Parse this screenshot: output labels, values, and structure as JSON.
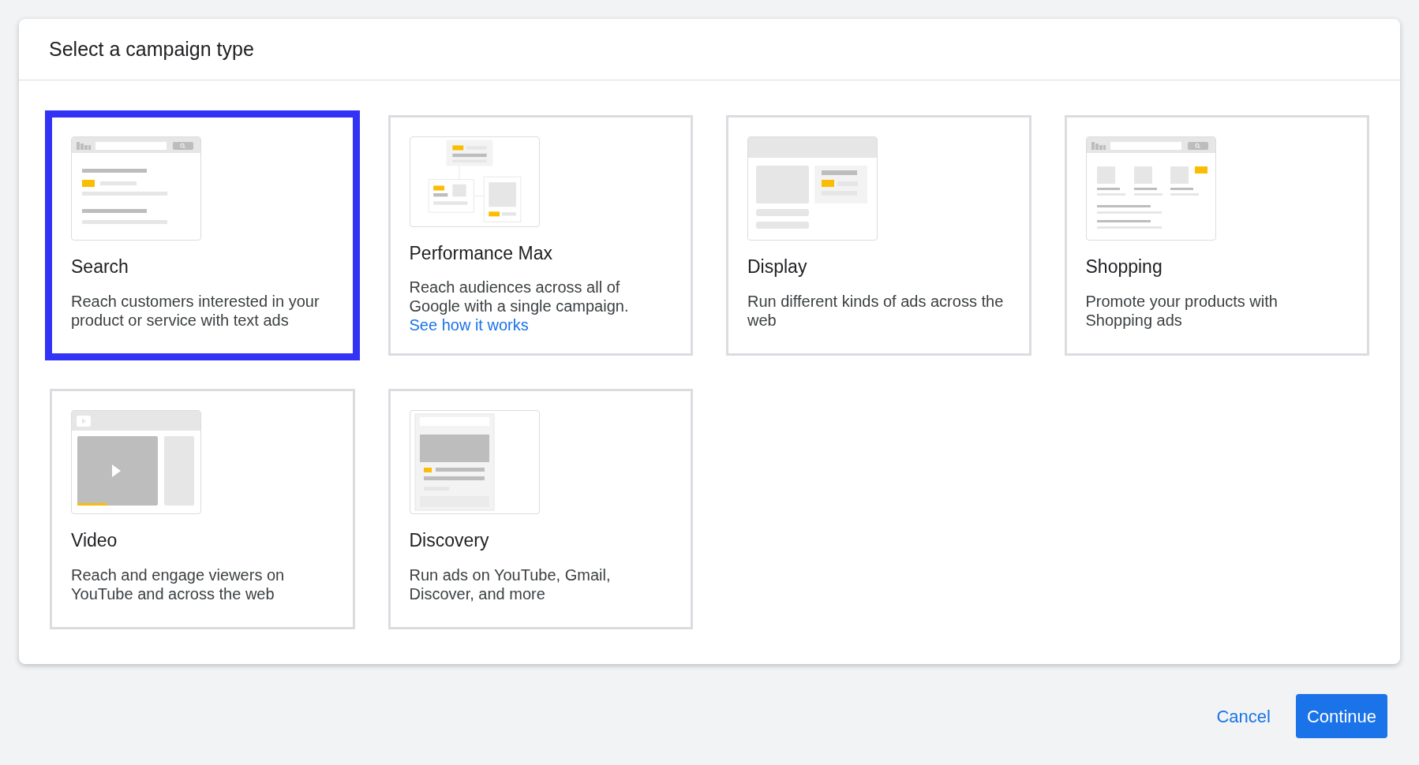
{
  "dialog": {
    "title": "Select a campaign type"
  },
  "cards": [
    {
      "kind": "search",
      "title": "Search",
      "description": "Reach customers interested in your product or service with text ads",
      "selected": true
    },
    {
      "kind": "performance_max",
      "title": "Performance Max",
      "description": "Reach audiences across all of Google with a single campaign.",
      "link": "See how it works",
      "selected": false
    },
    {
      "kind": "display",
      "title": "Display",
      "description": "Run different kinds of ads across the web",
      "selected": false
    },
    {
      "kind": "shopping",
      "title": "Shopping",
      "description": "Promote your products with Shopping ads",
      "selected": false
    },
    {
      "kind": "video",
      "title": "Video",
      "description": "Reach and engage viewers on YouTube and across the web",
      "selected": false
    },
    {
      "kind": "discovery",
      "title": "Discovery",
      "description": "Run ads on YouTube, Gmail, Discover, and more",
      "selected": false
    }
  ],
  "buttons": {
    "cancel": "Cancel",
    "continue": "Continue"
  }
}
